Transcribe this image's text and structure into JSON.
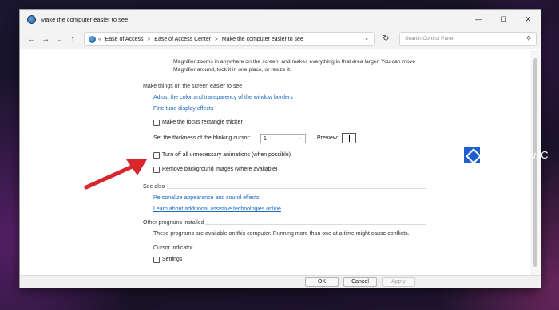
{
  "window": {
    "title": "Make the computer easier to see",
    "controls": {
      "minimize": "—",
      "maximize": "☐",
      "close": "✕"
    }
  },
  "toolbar": {
    "back": "←",
    "forward": "→",
    "recent": "⌄",
    "up": "↑",
    "breadcrumb": [
      "Ease of Access",
      "Ease of Access Center",
      "Make the computer easier to see"
    ],
    "breadcrumb_sep": ">",
    "breadcrumb_lead": "«",
    "dropdown": "⌄",
    "refresh": "↻",
    "search_placeholder": "Search Control Panel"
  },
  "main": {
    "intro_lines": [
      "Magnifier zooms in anywhere on the screen, and makes everything in that area larger. You can move",
      "Magnifier around, lock it in one place, or resize it."
    ],
    "section_easier": {
      "title": "Make things on the screen easier to see",
      "link_colors": "Adjust the color and transparency of the window borders",
      "link_finetune": "Fine tune display effects",
      "focus_rect_label": "Make the focus rectangle thicker",
      "focus_rect_checked": false,
      "cursor_thickness_label": "Set the thickness of the blinking cursor:",
      "cursor_thickness_value": "1",
      "preview_label": "Preview:",
      "animations_label": "Turn off all unnecessary animations (when possible)",
      "animations_checked": false,
      "bg_images_label": "Remove background images (where available)",
      "bg_images_checked": false
    },
    "section_see_also": {
      "title": "See also",
      "link_personalize": "Personalize appearance and sound effects",
      "link_learn": "Learn about additional assistive technologies online"
    },
    "section_other": {
      "title": "Other programs installed",
      "description": "These programs are available on this computer. Running more than one at a time might cause conflicts.",
      "subheading": "Cursor indicator",
      "settings_label": "Settings",
      "settings_checked": false
    }
  },
  "footer": {
    "ok": "OK",
    "cancel": "Cancel",
    "apply": "Apply"
  },
  "watermark": {
    "text": "TheWindowsC"
  },
  "colors": {
    "link": "#1a66c2",
    "annotation_arrow": "#d9262c",
    "window_bg": "#ffffff",
    "titlebar_bg": "#f3f3f3"
  }
}
